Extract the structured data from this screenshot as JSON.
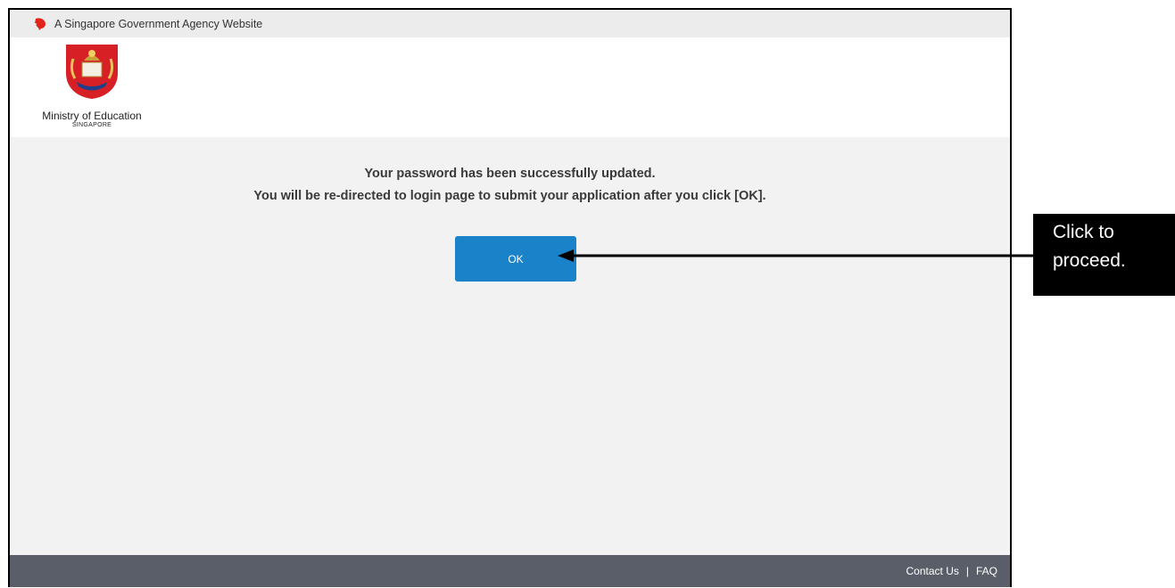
{
  "masthead": {
    "text": "A Singapore Government Agency Website",
    "icon": "lion-head-icon"
  },
  "logo": {
    "title": "Ministry of Education",
    "subtitle": "SINGAPORE",
    "icon": "moe-crest-icon"
  },
  "message": {
    "line1": "Your password has been successfully updated.",
    "line2": "You will be re-directed to login page to submit your application after you click [OK]."
  },
  "ok_button": {
    "label": "OK"
  },
  "footer": {
    "contact": "Contact Us",
    "separator": "|",
    "faq": "FAQ"
  },
  "annotation": {
    "text": "Click to proceed."
  },
  "colors": {
    "button": "#1a82c8",
    "footer": "#595e68",
    "lion": "#e2231a",
    "crest": "#d71f26"
  }
}
